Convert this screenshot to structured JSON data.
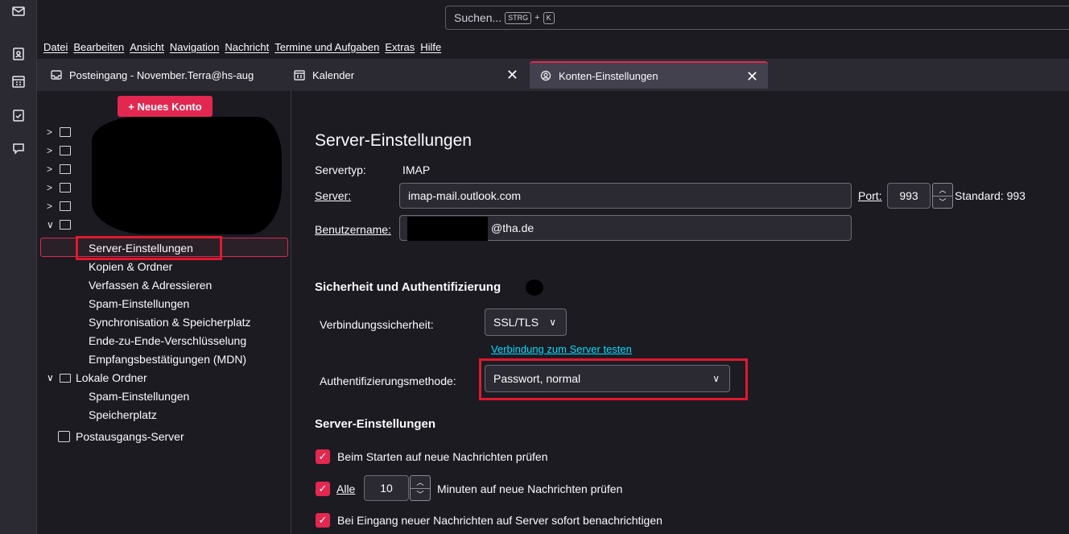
{
  "search": {
    "placeholder": "Suchen...",
    "key1": "STRG",
    "plus": "+",
    "key2": "K"
  },
  "menu": [
    "Datei",
    "Bearbeiten",
    "Ansicht",
    "Navigation",
    "Nachricht",
    "Termine und Aufgaben",
    "Extras",
    "Hilfe"
  ],
  "tabs": [
    {
      "label": "Posteingang - November.Terra@hs-aug",
      "icon": "inbox-icon",
      "closable": false
    },
    {
      "label": "Kalender",
      "icon": "calendar-icon",
      "closable": true
    },
    {
      "label": "Konten-Einstellungen",
      "icon": "account-settings-icon",
      "closable": true,
      "active": true
    }
  ],
  "close_glyph": "✕",
  "spaces": [
    "mail-icon",
    "address-book-icon",
    "calendar-icon",
    "tasks-icon",
    "chat-icon"
  ],
  "sidebar": {
    "new_account": "+ Neues Konto",
    "account_items": [
      "Server-Einstellungen",
      "Kopien & Ordner",
      "Verfassen & Adressieren",
      "Spam-Einstellungen",
      "Synchronisation & Speicherplatz",
      "Ende-zu-Ende-Verschlüsselung",
      "Empfangsbestätigungen (MDN)"
    ],
    "local_folders": "Lokale Ordner",
    "local_items": [
      "Spam-Einstellungen",
      "Speicherplatz"
    ],
    "outgoing": "Postausgangs-Server"
  },
  "main": {
    "title": "Server-Einstellungen",
    "server_type_label": "Servertyp:",
    "server_type_value": "IMAP",
    "server_label": "Server:",
    "server_value": "imap-mail.outlook.com",
    "port_label": "Port:",
    "port_value": "993",
    "port_default": "Standard: 993",
    "username_label": "Benutzername:",
    "username_value": "@tha.de",
    "security_heading": "Sicherheit und Authentifizierung",
    "conn_security_label": "Verbindungssicherheit:",
    "conn_security_value": "SSL/TLS",
    "test_link": "Verbindung zum Server testen",
    "auth_label": "Authentifizierungsmethode:",
    "auth_value": "Passwort, normal",
    "server_settings_heading": "Server-Einstellungen",
    "check_startup": "Beim Starten auf neue Nachrichten prüfen",
    "check_every_label": "Alle",
    "check_every_value": "10",
    "check_every_suffix": "Minuten auf neue Nachrichten prüfen",
    "notify_label": "Bei Eingang neuer Nachrichten auf Server sofort benachrichtigen"
  },
  "colors": {
    "accent": "#e22850",
    "highlight": "#e0192f",
    "link": "#00ddff"
  }
}
